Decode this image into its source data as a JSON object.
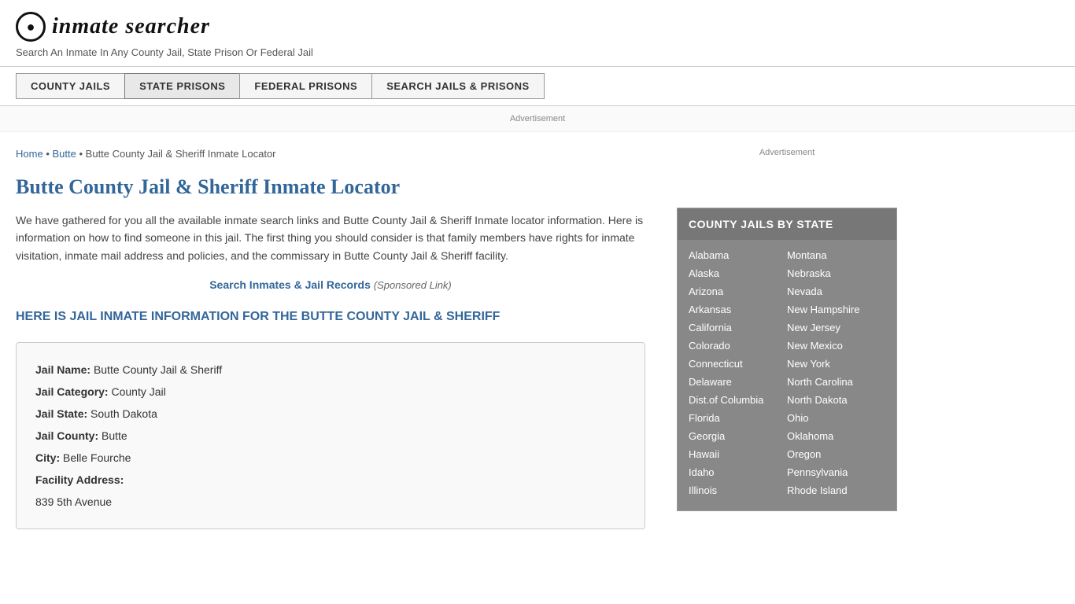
{
  "header": {
    "logo_symbol": "🔍",
    "logo_text_part1": "inmate",
    "logo_text_part2": "searcher",
    "tagline": "Search An Inmate In Any County Jail, State Prison Or Federal Jail"
  },
  "nav": {
    "buttons": [
      {
        "label": "COUNTY JAILS",
        "id": "county-jails"
      },
      {
        "label": "STATE PRISONS",
        "id": "state-prisons",
        "active": true
      },
      {
        "label": "FEDERAL PRISONS",
        "id": "federal-prisons"
      },
      {
        "label": "SEARCH JAILS & PRISONS",
        "id": "search-jails"
      }
    ]
  },
  "ad_label": "Advertisement",
  "breadcrumb": {
    "home": "Home",
    "sep1": "•",
    "butte": "Butte",
    "sep2": "•",
    "current": "Butte County Jail & Sheriff Inmate Locator"
  },
  "main": {
    "page_title": "Butte County Jail & Sheriff Inmate Locator",
    "description": "We have gathered for you all the available inmate search links and Butte County Jail & Sheriff Inmate locator information. Here is information on how to find someone in this jail. The first thing you should consider is that family members have rights for inmate visitation, inmate mail address and policies, and the commissary in Butte County Jail & Sheriff facility.",
    "sponsored_link_text": "Search Inmates & Jail Records",
    "sponsored_link_suffix": "(Sponsored Link)",
    "section_heading": "HERE IS JAIL INMATE INFORMATION FOR THE BUTTE COUNTY JAIL & SHERIFF",
    "info": {
      "jail_name_label": "Jail Name:",
      "jail_name_value": "Butte County Jail & Sheriff",
      "jail_category_label": "Jail Category:",
      "jail_category_value": "County Jail",
      "jail_state_label": "Jail State:",
      "jail_state_value": "South Dakota",
      "jail_county_label": "Jail County:",
      "jail_county_value": "Butte",
      "city_label": "City:",
      "city_value": "Belle Fourche",
      "facility_address_label": "Facility Address:",
      "facility_address_value": "839 5th Avenue"
    }
  },
  "sidebar": {
    "ad_label": "Advertisement",
    "county_jails_title": "COUNTY JAILS BY STATE",
    "states_col1": [
      "Alabama",
      "Alaska",
      "Arizona",
      "Arkansas",
      "California",
      "Colorado",
      "Connecticut",
      "Delaware",
      "Dist.of Columbia",
      "Florida",
      "Georgia",
      "Hawaii",
      "Idaho",
      "Illinois"
    ],
    "states_col2": [
      "Montana",
      "Nebraska",
      "Nevada",
      "New Hampshire",
      "New Jersey",
      "New Mexico",
      "New York",
      "North Carolina",
      "North Dakota",
      "Ohio",
      "Oklahoma",
      "Oregon",
      "Pennsylvania",
      "Rhode Island"
    ]
  }
}
